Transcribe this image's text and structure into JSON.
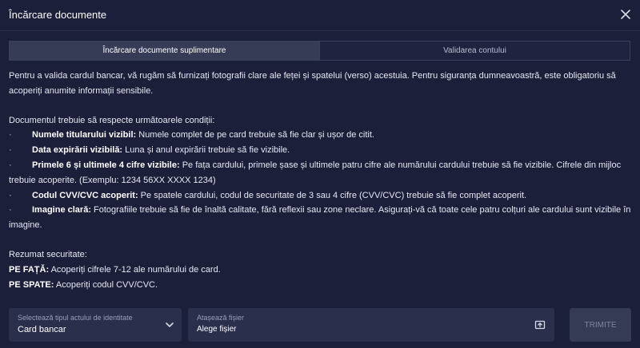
{
  "modal": {
    "title": "Încărcare documente"
  },
  "tabs": [
    {
      "label": "Încărcare documente suplimentare"
    },
    {
      "label": "Validarea contului"
    }
  ],
  "intro": "Pentru a valida cardul bancar, vă rugăm să furnizați fotografii clare ale feței și spatelui (verso) acestuia. Pentru siguranța dumneavoastră, este obligatoriu să acoperiți anumite informații sensibile.",
  "conditions": {
    "heading": "Documentul trebuie să respecte următoarele condiții:",
    "bullet": "·",
    "items": [
      {
        "title": "Numele titularului vizibil:",
        "text": " Numele complet de pe card trebuie să fie clar și ușor de citit."
      },
      {
        "title": "Data expirării vizibilă:",
        "text": " Luna și anul expirării trebuie să fie vizibile."
      },
      {
        "title": "Primele 6 și ultimele 4 cifre vizibile:",
        "text": " Pe fața cardului, primele șase și ultimele patru cifre ale numărului cardului trebuie să fie vizibile. Cifrele din mijloc trebuie acoperite. (Exemplu: 1234 56XX XXXX 1234)"
      },
      {
        "title": "Codul CVV/CVC acoperit:",
        "text": " Pe spatele cardului, codul de securitate de 3 sau 4 cifre (CVV/CVC) trebuie să fie complet acoperit."
      },
      {
        "title": "Imagine clară:",
        "text": " Fotografiile trebuie să fie de înaltă calitate, fără reflexii sau zone neclare. Asigurați-vă că toate cele patru colțuri ale cardului sunt vizibile în imagine."
      }
    ]
  },
  "summary": {
    "heading": "Rezumat securitate:",
    "front_label": "PE FAȚĂ:",
    "front_text": " Acoperiți cifrele 7-12 ale numărului de card.",
    "back_label": "PE SPATE:",
    "back_text": " Acoperiți codul CVV/CVC."
  },
  "footer": {
    "id_type": {
      "label": "Selectează tipul actului de identitate",
      "value": "Card bancar"
    },
    "attach": {
      "label": "Atașează fișier",
      "value": "Alege fișier"
    },
    "submit_label": "TRIMITE"
  },
  "icons": {
    "close": "close-icon",
    "chevron": "chevron-down-icon",
    "upload": "upload-icon"
  },
  "colors": {
    "background": "#1b1f3a",
    "tab_active": "#363c56",
    "field_bg": "#2a2f4b",
    "submit_disabled": "#363b55"
  }
}
